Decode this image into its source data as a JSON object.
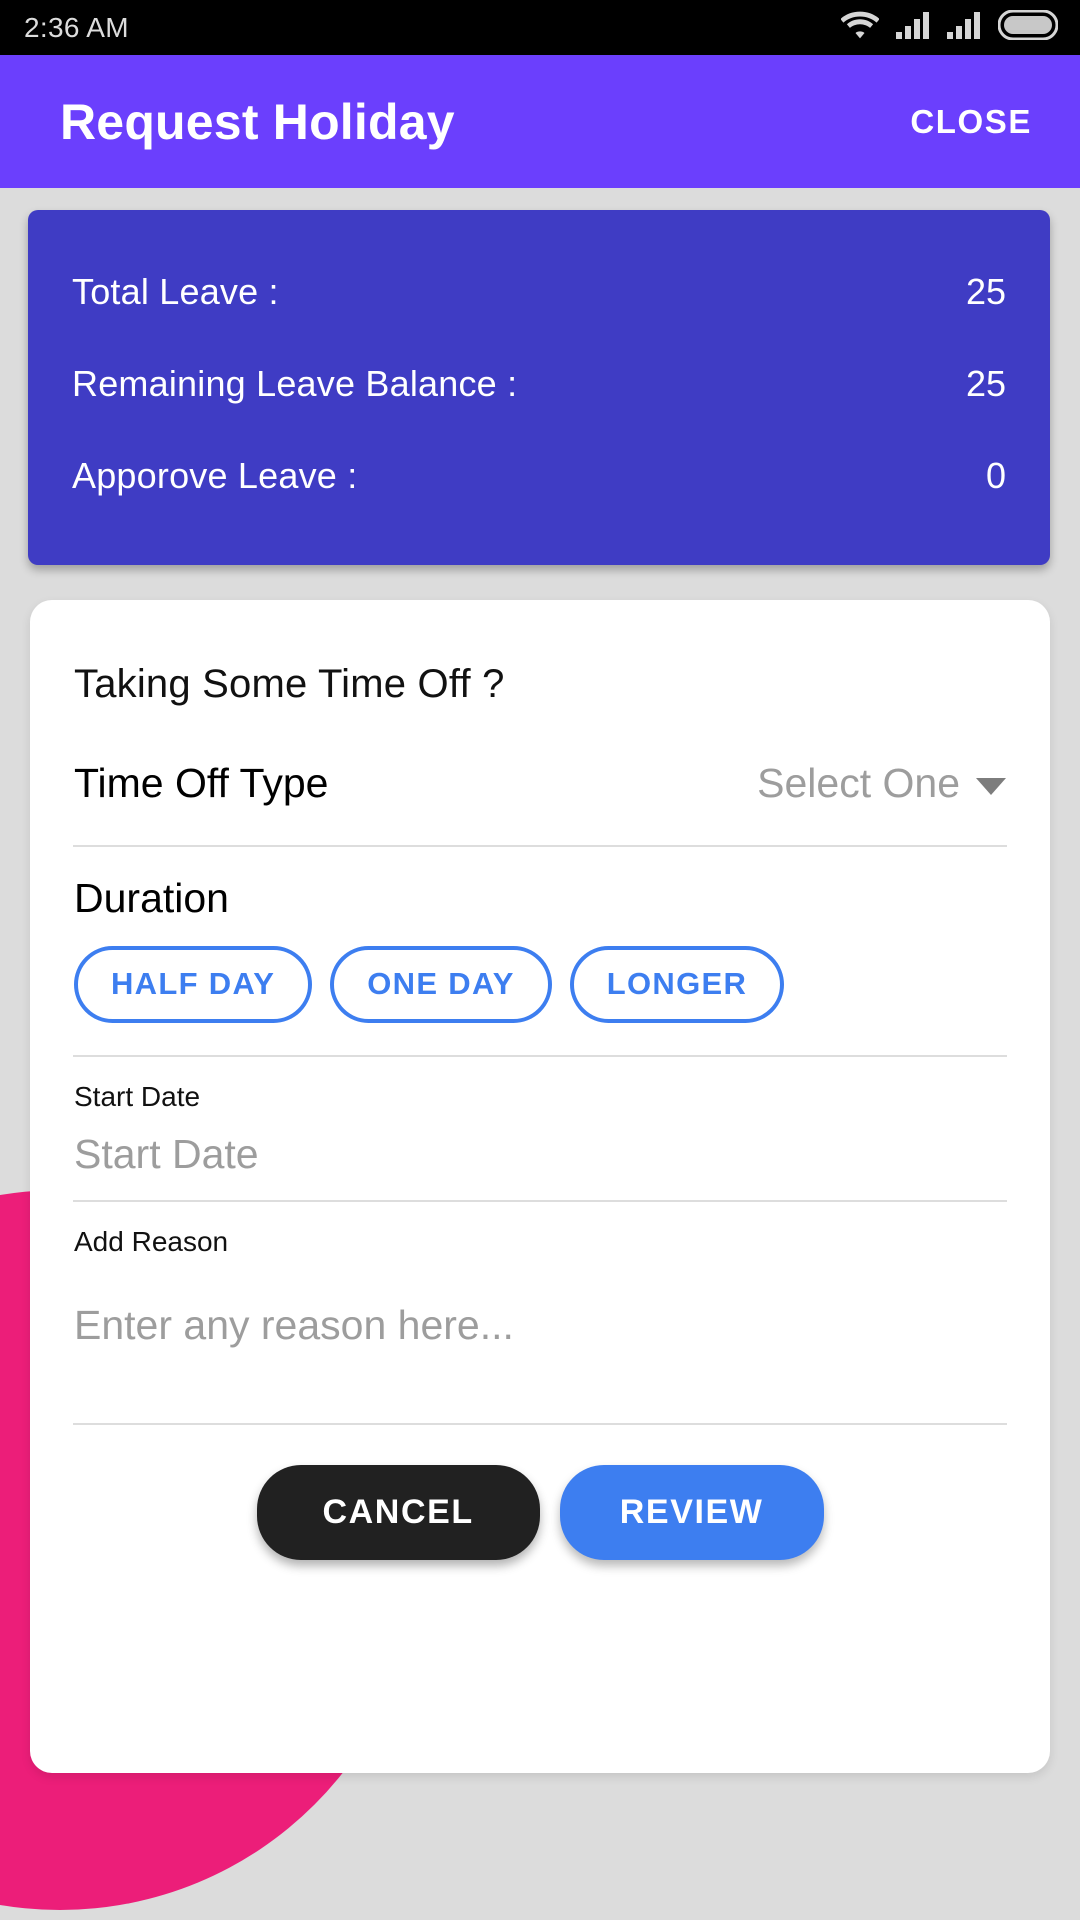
{
  "status_bar": {
    "time": "2:36 AM",
    "icons": [
      "wifi-icon",
      "signal-icon",
      "signal-icon",
      "battery-icon"
    ]
  },
  "app_bar": {
    "title": "Request Holiday",
    "close_label": "CLOSE",
    "background_color": "#6b3ffd"
  },
  "leave_summary": {
    "background_color": "#3f3cc4",
    "rows": [
      {
        "label": "Total Leave :",
        "value": "25"
      },
      {
        "label": "Remaining Leave Balance :",
        "value": "25"
      },
      {
        "label": "Apporove Leave :",
        "value": "0"
      }
    ]
  },
  "form": {
    "heading": "Taking Some Time Off ?",
    "time_off_type": {
      "label": "Time Off Type",
      "selected": "Select One",
      "caret_icon": "chevron-down-icon"
    },
    "duration": {
      "label": "Duration",
      "options": [
        "HALF DAY",
        "ONE DAY",
        "LONGER"
      ],
      "accent_color": "#3d7ef0"
    },
    "start_date": {
      "label": "Start Date",
      "placeholder": "Start Date"
    },
    "reason": {
      "label": "Add Reason",
      "placeholder": "Enter any reason here..."
    },
    "actions": {
      "cancel_label": "CANCEL",
      "review_label": "REVIEW",
      "cancel_color": "#212121",
      "review_color": "#3d7ef0"
    }
  },
  "decoration": {
    "blob_color": "#ec1e79",
    "page_background": "#dcdcdc"
  }
}
